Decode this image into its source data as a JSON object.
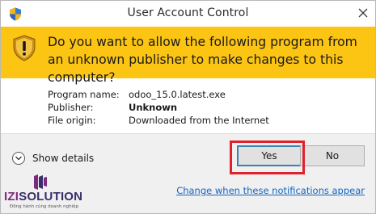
{
  "window": {
    "title": "User Account Control",
    "close_icon": "close-icon"
  },
  "banner": {
    "question": "Do you want to allow the following program from an unknown publisher to make changes to this computer?",
    "color": "#fcc514",
    "icon": "uac-shield-icon"
  },
  "details": {
    "program_name_label": "Program name:",
    "program_name_value": "odoo_15.0.latest.exe",
    "publisher_label": "Publisher:",
    "publisher_value": "Unknown",
    "file_origin_label": "File origin:",
    "file_origin_value": "Downloaded from the Internet"
  },
  "footer": {
    "show_details_label": "Show details",
    "yes_label": "Yes",
    "no_label": "No",
    "notifications_link": "Change when these notifications appear",
    "highlight_color": "#e0202a"
  },
  "watermark": {
    "brand_prefix": "IZI",
    "brand_suffix": "SOLUTION",
    "tagline": "Đồng hành cùng doanh nghiệp"
  }
}
